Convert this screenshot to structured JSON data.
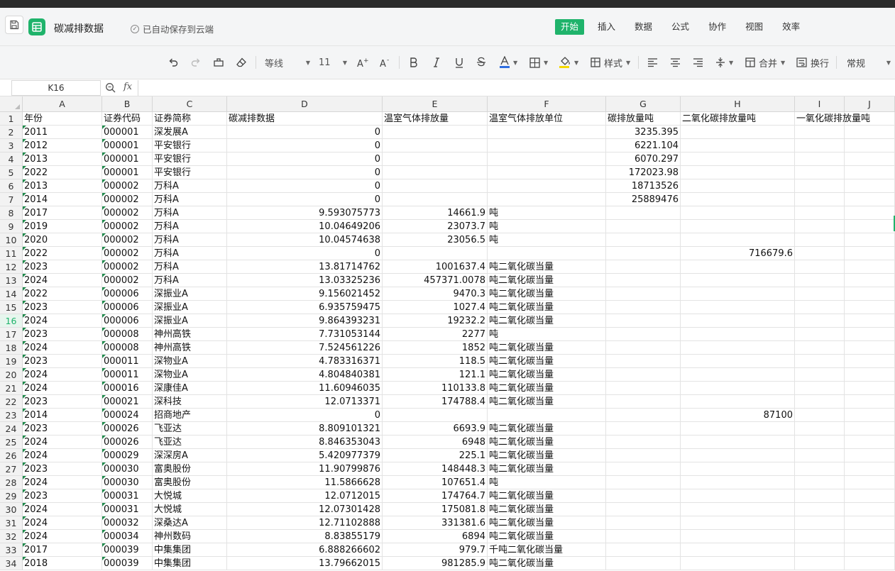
{
  "title_bar": {
    "doc_title": "碳减排数据",
    "autosave_text": "已自动保存到云端",
    "tabs": [
      {
        "label": "开始",
        "active": true
      },
      {
        "label": "插入",
        "active": false
      },
      {
        "label": "数据",
        "active": false
      },
      {
        "label": "公式",
        "active": false
      },
      {
        "label": "协作",
        "active": false
      },
      {
        "label": "视图",
        "active": false
      },
      {
        "label": "效率",
        "active": false
      }
    ]
  },
  "toolbar": {
    "font_name": "等线",
    "font_size": "11",
    "style_label": "样式",
    "merge_label": "合并",
    "wrap_label": "换行",
    "number_format": "常规",
    "accent_color": "#1fb36b",
    "font_color_bar": "#2f6ee0",
    "fill_color_bar": "#f5d800"
  },
  "formula_bar": {
    "cell_ref": "K16",
    "fx_label": "fx",
    "formula": ""
  },
  "sheet": {
    "columns": [
      "A",
      "B",
      "C",
      "D",
      "E",
      "F",
      "G",
      "H",
      "I",
      "J"
    ],
    "active_row": 16,
    "header_row": [
      "年份",
      "证券代码",
      "证券简称",
      "碳减排数据",
      "温室气体排放量",
      "温室气体排放单位",
      "碳排放量吨",
      "二氧化碳排放量吨",
      "一氧化碳排放量吨",
      ""
    ],
    "rows": [
      {
        "n": "1"
      },
      {
        "n": "2",
        "year": "2011",
        "code": "000001",
        "name": "深发展A",
        "d": "0",
        "e": "",
        "f": "",
        "g": "3235.395",
        "h": ""
      },
      {
        "n": "3",
        "year": "2012",
        "code": "000001",
        "name": "平安银行",
        "d": "0",
        "e": "",
        "f": "",
        "g": "6221.104",
        "h": ""
      },
      {
        "n": "4",
        "year": "2013",
        "code": "000001",
        "name": "平安银行",
        "d": "0",
        "e": "",
        "f": "",
        "g": "6070.297",
        "h": ""
      },
      {
        "n": "5",
        "year": "2022",
        "code": "000001",
        "name": "平安银行",
        "d": "0",
        "e": "",
        "f": "",
        "g": "172023.98",
        "h": ""
      },
      {
        "n": "6",
        "year": "2013",
        "code": "000002",
        "name": "万科A",
        "d": "0",
        "e": "",
        "f": "",
        "g": "18713526",
        "h": ""
      },
      {
        "n": "7",
        "year": "2014",
        "code": "000002",
        "name": "万科A",
        "d": "0",
        "e": "",
        "f": "",
        "g": "25889476",
        "h": ""
      },
      {
        "n": "8",
        "year": "2017",
        "code": "000002",
        "name": "万科A",
        "d": "9.593075773",
        "e": "14661.9",
        "f": "吨",
        "g": "",
        "h": ""
      },
      {
        "n": "9",
        "year": "2019",
        "code": "000002",
        "name": "万科A",
        "d": "10.04649206",
        "e": "23073.7",
        "f": "吨",
        "g": "",
        "h": ""
      },
      {
        "n": "10",
        "year": "2020",
        "code": "000002",
        "name": "万科A",
        "d": "10.04574638",
        "e": "23056.5",
        "f": "吨",
        "g": "",
        "h": ""
      },
      {
        "n": "11",
        "year": "2022",
        "code": "000002",
        "name": "万科A",
        "d": "0",
        "e": "",
        "f": "",
        "g": "",
        "h": "716679.6"
      },
      {
        "n": "12",
        "year": "2023",
        "code": "000002",
        "name": "万科A",
        "d": "13.81714762",
        "e": "1001637.4",
        "f": "吨二氧化碳当量",
        "g": "",
        "h": ""
      },
      {
        "n": "13",
        "year": "2024",
        "code": "000002",
        "name": "万科A",
        "d": "13.03325236",
        "e": "457371.0078",
        "f": "吨二氧化碳当量",
        "g": "",
        "h": ""
      },
      {
        "n": "14",
        "year": "2022",
        "code": "000006",
        "name": "深振业A",
        "d": "9.156021452",
        "e": "9470.3",
        "f": "吨二氧化碳当量",
        "g": "",
        "h": ""
      },
      {
        "n": "15",
        "year": "2023",
        "code": "000006",
        "name": "深振业A",
        "d": "6.935759475",
        "e": "1027.4",
        "f": "吨二氧化碳当量",
        "g": "",
        "h": ""
      },
      {
        "n": "16",
        "year": "2024",
        "code": "000006",
        "name": "深振业A",
        "d": "9.864393231",
        "e": "19232.2",
        "f": "吨二氧化碳当量",
        "g": "",
        "h": ""
      },
      {
        "n": "17",
        "year": "2023",
        "code": "000008",
        "name": "神州高铁",
        "d": "7.731053144",
        "e": "2277",
        "f": "吨",
        "g": "",
        "h": ""
      },
      {
        "n": "18",
        "year": "2024",
        "code": "000008",
        "name": "神州高铁",
        "d": "7.524561226",
        "e": "1852",
        "f": "吨二氧化碳当量",
        "g": "",
        "h": ""
      },
      {
        "n": "19",
        "year": "2023",
        "code": "000011",
        "name": "深物业A",
        "d": "4.783316371",
        "e": "118.5",
        "f": "吨二氧化碳当量",
        "g": "",
        "h": ""
      },
      {
        "n": "20",
        "year": "2024",
        "code": "000011",
        "name": "深物业A",
        "d": "4.804840381",
        "e": "121.1",
        "f": "吨二氧化碳当量",
        "g": "",
        "h": ""
      },
      {
        "n": "21",
        "year": "2024",
        "code": "000016",
        "name": "深康佳A",
        "d": "11.60946035",
        "e": "110133.8",
        "f": "吨二氧化碳当量",
        "g": "",
        "h": ""
      },
      {
        "n": "22",
        "year": "2023",
        "code": "000021",
        "name": "深科技",
        "d": "12.0713371",
        "e": "174788.4",
        "f": "吨二氧化碳当量",
        "g": "",
        "h": ""
      },
      {
        "n": "23",
        "year": "2014",
        "code": "000024",
        "name": "招商地产",
        "d": "0",
        "e": "",
        "f": "",
        "g": "",
        "h": "87100"
      },
      {
        "n": "24",
        "year": "2023",
        "code": "000026",
        "name": "飞亚达",
        "d": "8.809101321",
        "e": "6693.9",
        "f": "吨二氧化碳当量",
        "g": "",
        "h": ""
      },
      {
        "n": "25",
        "year": "2024",
        "code": "000026",
        "name": "飞亚达",
        "d": "8.846353043",
        "e": "6948",
        "f": "吨二氧化碳当量",
        "g": "",
        "h": ""
      },
      {
        "n": "26",
        "year": "2024",
        "code": "000029",
        "name": "深深房A",
        "d": "5.420977379",
        "e": "225.1",
        "f": "吨二氧化碳当量",
        "g": "",
        "h": ""
      },
      {
        "n": "27",
        "year": "2023",
        "code": "000030",
        "name": "富奥股份",
        "d": "11.90799876",
        "e": "148448.3",
        "f": "吨二氧化碳当量",
        "g": "",
        "h": ""
      },
      {
        "n": "28",
        "year": "2024",
        "code": "000030",
        "name": "富奥股份",
        "d": "11.5866628",
        "e": "107651.4",
        "f": "吨",
        "g": "",
        "h": ""
      },
      {
        "n": "29",
        "year": "2023",
        "code": "000031",
        "name": "大悦城",
        "d": "12.0712015",
        "e": "174764.7",
        "f": "吨二氧化碳当量",
        "g": "",
        "h": ""
      },
      {
        "n": "30",
        "year": "2024",
        "code": "000031",
        "name": "大悦城",
        "d": "12.07301428",
        "e": "175081.8",
        "f": "吨二氧化碳当量",
        "g": "",
        "h": ""
      },
      {
        "n": "31",
        "year": "2024",
        "code": "000032",
        "name": "深桑达A",
        "d": "12.71102888",
        "e": "331381.6",
        "f": "吨二氧化碳当量",
        "g": "",
        "h": ""
      },
      {
        "n": "32",
        "year": "2024",
        "code": "000034",
        "name": "神州数码",
        "d": "8.83855179",
        "e": "6894",
        "f": "吨二氧化碳当量",
        "g": "",
        "h": ""
      },
      {
        "n": "33",
        "year": "2017",
        "code": "000039",
        "name": "中集集团",
        "d": "6.888266602",
        "e": "979.7",
        "f": "千吨二氧化碳当量",
        "g": "",
        "h": ""
      },
      {
        "n": "34",
        "year": "2018",
        "code": "000039",
        "name": "中集集团",
        "d": "13.79662015",
        "e": "981285.9",
        "f": "吨二氧化碳当量",
        "g": "",
        "h": ""
      }
    ]
  }
}
